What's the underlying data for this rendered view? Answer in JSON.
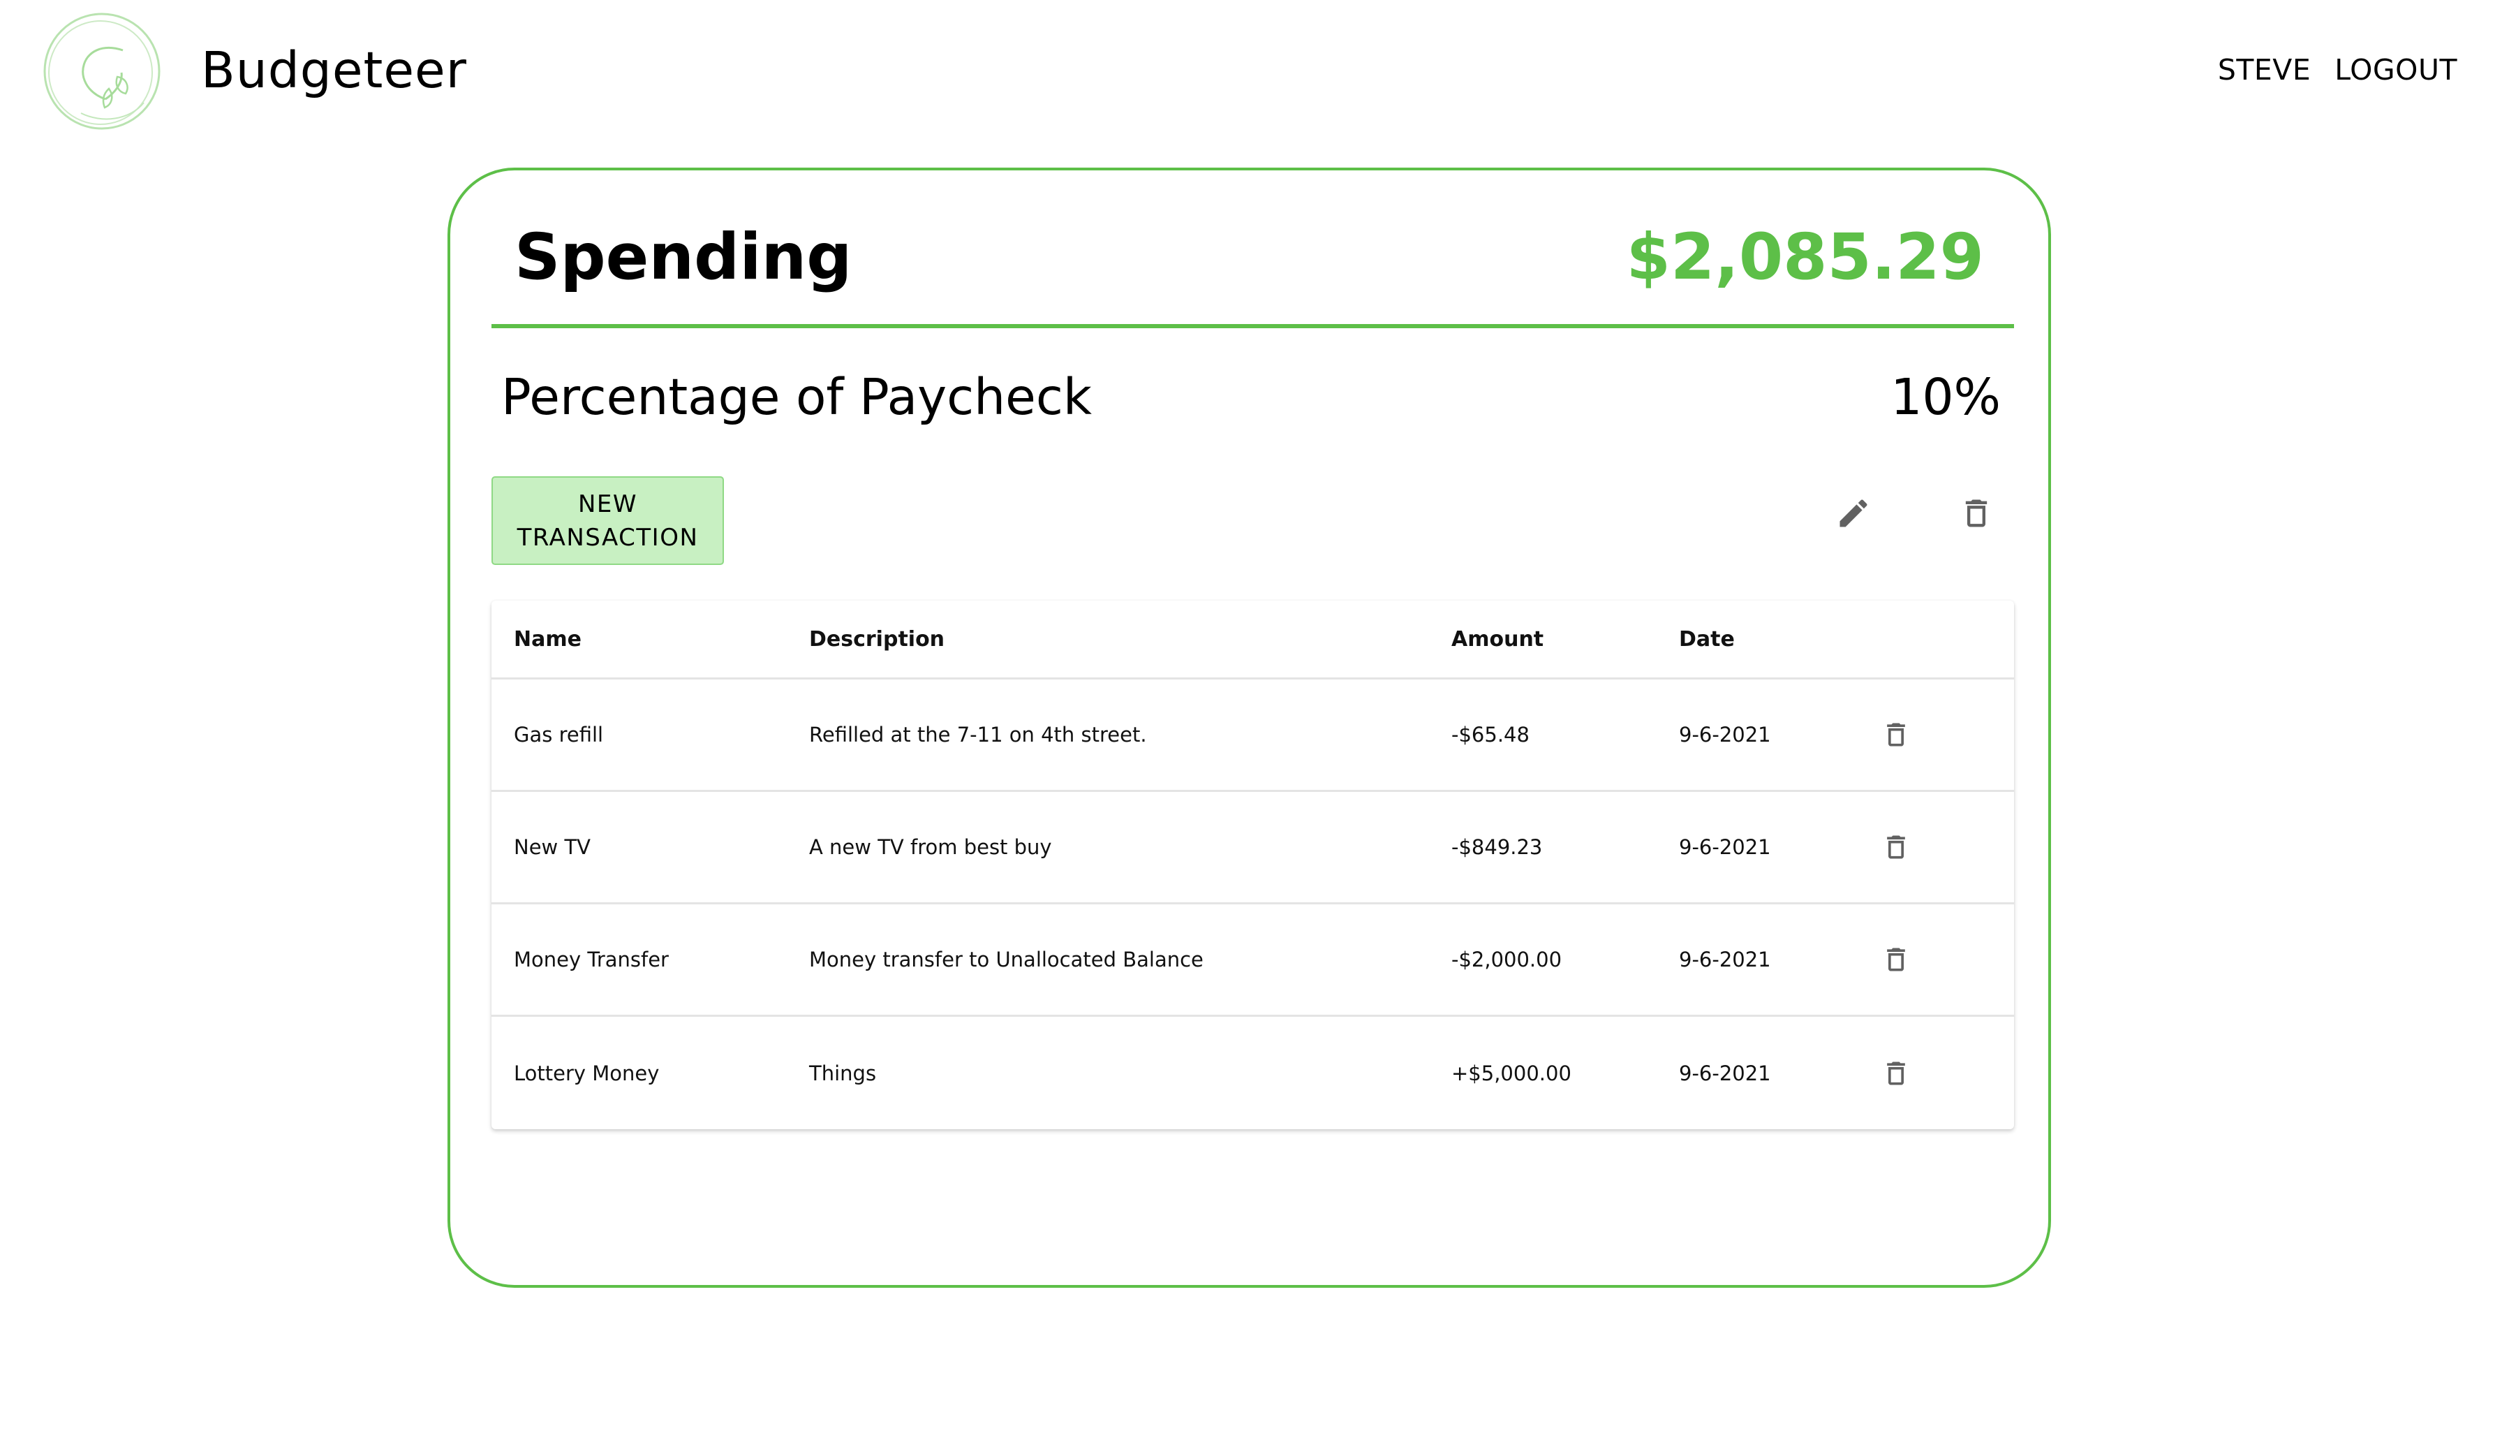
{
  "app": {
    "title": "Budgeteer"
  },
  "nav": {
    "user": "STEVE",
    "logout": "LOGOUT"
  },
  "budget": {
    "title": "Spending",
    "total": "$2,085.29",
    "percentage_label": "Percentage of Paycheck",
    "percentage_value": "10%",
    "new_transaction_label_line1": "NEW",
    "new_transaction_label_line2": "TRANSACTION",
    "accent_color": "#5dbf48",
    "button_color": "#c8f0c2"
  },
  "icons": {
    "edit": "pencil-icon",
    "delete": "trash-icon",
    "logo": "leaf-circle-logo"
  },
  "table": {
    "headers": {
      "name": "Name",
      "description": "Description",
      "amount": "Amount",
      "date": "Date"
    },
    "rows": [
      {
        "name": "Gas refill",
        "description": "Refilled at the 7-11 on 4th street.",
        "amount": "-$65.48",
        "date": "9-6-2021"
      },
      {
        "name": "New TV",
        "description": "A new TV from best buy",
        "amount": "-$849.23",
        "date": "9-6-2021"
      },
      {
        "name": "Money Transfer",
        "description": "Money transfer to Unallocated Balance",
        "amount": "-$2,000.00",
        "date": "9-6-2021"
      },
      {
        "name": "Lottery Money",
        "description": "Things",
        "amount": "+$5,000.00",
        "date": "9-6-2021"
      }
    ]
  }
}
